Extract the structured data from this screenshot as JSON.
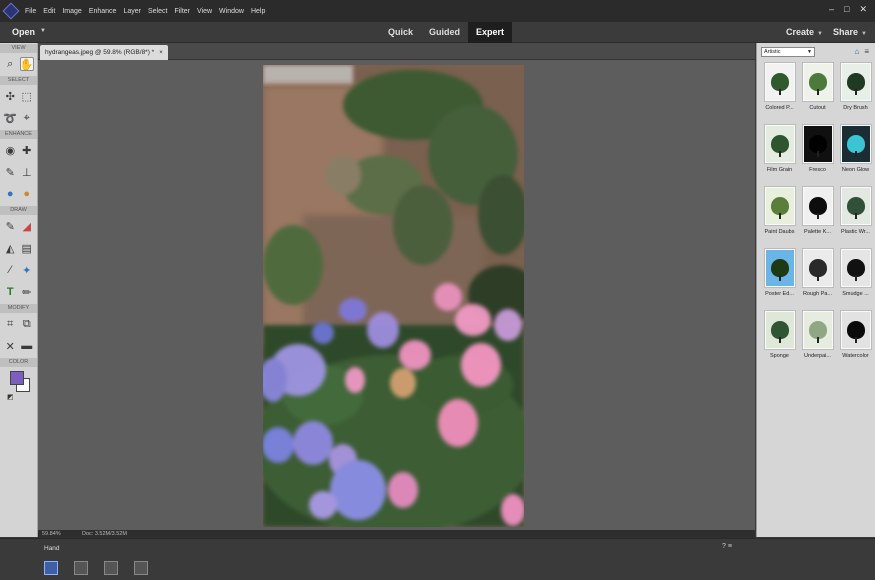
{
  "menu": {
    "items": [
      "File",
      "Edit",
      "Image",
      "Enhance",
      "Layer",
      "Select",
      "Filter",
      "View",
      "Window",
      "Help"
    ],
    "window_controls": [
      "–",
      "□",
      "✕"
    ]
  },
  "modebar": {
    "open_label": "Open",
    "modes": [
      "Quick",
      "Guided",
      "Expert"
    ],
    "active_mode": "Expert",
    "create_label": "Create",
    "share_label": "Share"
  },
  "toolbar": {
    "sections": [
      "VIEW",
      "SELECT",
      "ENHANCE",
      "DRAW",
      "MODIFY",
      "COLOR"
    ],
    "tools": {
      "view": [
        {
          "icon": "zoom-icon",
          "glyph": "⌕"
        },
        {
          "icon": "hand-icon",
          "glyph": "✋"
        }
      ],
      "select": [
        {
          "icon": "move-icon",
          "glyph": "✣"
        },
        {
          "icon": "marquee-icon",
          "glyph": "⬚"
        },
        {
          "icon": "lasso-icon",
          "glyph": "➰"
        },
        {
          "icon": "quick-select-icon",
          "glyph": "⌖"
        }
      ],
      "enhance": [
        {
          "icon": "red-eye-icon",
          "glyph": "👁"
        },
        {
          "icon": "healing-icon",
          "glyph": "✚"
        },
        {
          "icon": "smart-brush-icon",
          "glyph": "✎"
        },
        {
          "icon": "clone-stamp-icon",
          "glyph": "⊥"
        },
        {
          "icon": "blur-icon",
          "glyph": "💧"
        },
        {
          "icon": "sponge-icon",
          "glyph": "●"
        }
      ],
      "draw": [
        {
          "icon": "brush-icon",
          "glyph": "✎"
        },
        {
          "icon": "eraser-icon",
          "glyph": "◢"
        },
        {
          "icon": "paint-bucket-icon",
          "glyph": "♨"
        },
        {
          "icon": "gradient-icon",
          "glyph": "▤"
        },
        {
          "icon": "eyedropper-icon",
          "glyph": "⁄"
        },
        {
          "icon": "custom-shape-icon",
          "glyph": "✦"
        },
        {
          "icon": "type-icon",
          "glyph": "T"
        },
        {
          "icon": "pencil-icon",
          "glyph": "✏"
        }
      ],
      "modify": [
        {
          "icon": "crop-icon",
          "glyph": "⌗"
        },
        {
          "icon": "recompose-icon",
          "glyph": "⧉"
        },
        {
          "icon": "content-aware-move-icon",
          "glyph": "✕"
        },
        {
          "icon": "straighten-icon",
          "glyph": "▬"
        }
      ]
    },
    "foreground_color": "#7a5fc0",
    "background_color": "#ffffff"
  },
  "document": {
    "tab_label": "hydrangeas.jpeg @ 59.8% (RGB/8*) *",
    "close_glyph": "×"
  },
  "status": {
    "zoom": "59.84%",
    "doc_size": "Doc: 3.52M/3.52M"
  },
  "effects_panel": {
    "category": "Artistic",
    "items": [
      {
        "label": "Colored P...",
        "bg": "#f2f2f2",
        "fg": "#2e5a2e"
      },
      {
        "label": "Cutout",
        "bg": "#eef2ea",
        "fg": "#4b7a3a"
      },
      {
        "label": "Dry Brush",
        "bg": "#e8efe8",
        "fg": "#1f3a22"
      },
      {
        "label": "Film Grain",
        "bg": "#e4ebe1",
        "fg": "#2f5530"
      },
      {
        "label": "Fresco",
        "bg": "#101010",
        "fg": "#000000"
      },
      {
        "label": "Neon Glow",
        "bg": "#1c2c33",
        "fg": "#3bc4d4"
      },
      {
        "label": "Paint Daubs",
        "bg": "#e9efdd",
        "fg": "#5b7f3a"
      },
      {
        "label": "Palette K...",
        "bg": "#f0f0f0",
        "fg": "#0d0d0d"
      },
      {
        "label": "Plastic Wr...",
        "bg": "#e3e8e3",
        "fg": "#30503a"
      },
      {
        "label": "Poster Ed...",
        "bg": "#6ab4e6",
        "fg": "#1d3a12"
      },
      {
        "label": "Rough Pa...",
        "bg": "#ebebeb",
        "fg": "#2a2a2a"
      },
      {
        "label": "Smudge ...",
        "bg": "#e5e5e5",
        "fg": "#111111"
      },
      {
        "label": "Sponge",
        "bg": "#dfe8d8",
        "fg": "#2f5532"
      },
      {
        "label": "Underpai...",
        "bg": "#e6ece0",
        "fg": "#8fa883"
      },
      {
        "label": "Watercolor",
        "bg": "#e2e2e2",
        "fg": "#0a0a0a"
      }
    ]
  },
  "bottom": {
    "tool_name": "Hand"
  }
}
